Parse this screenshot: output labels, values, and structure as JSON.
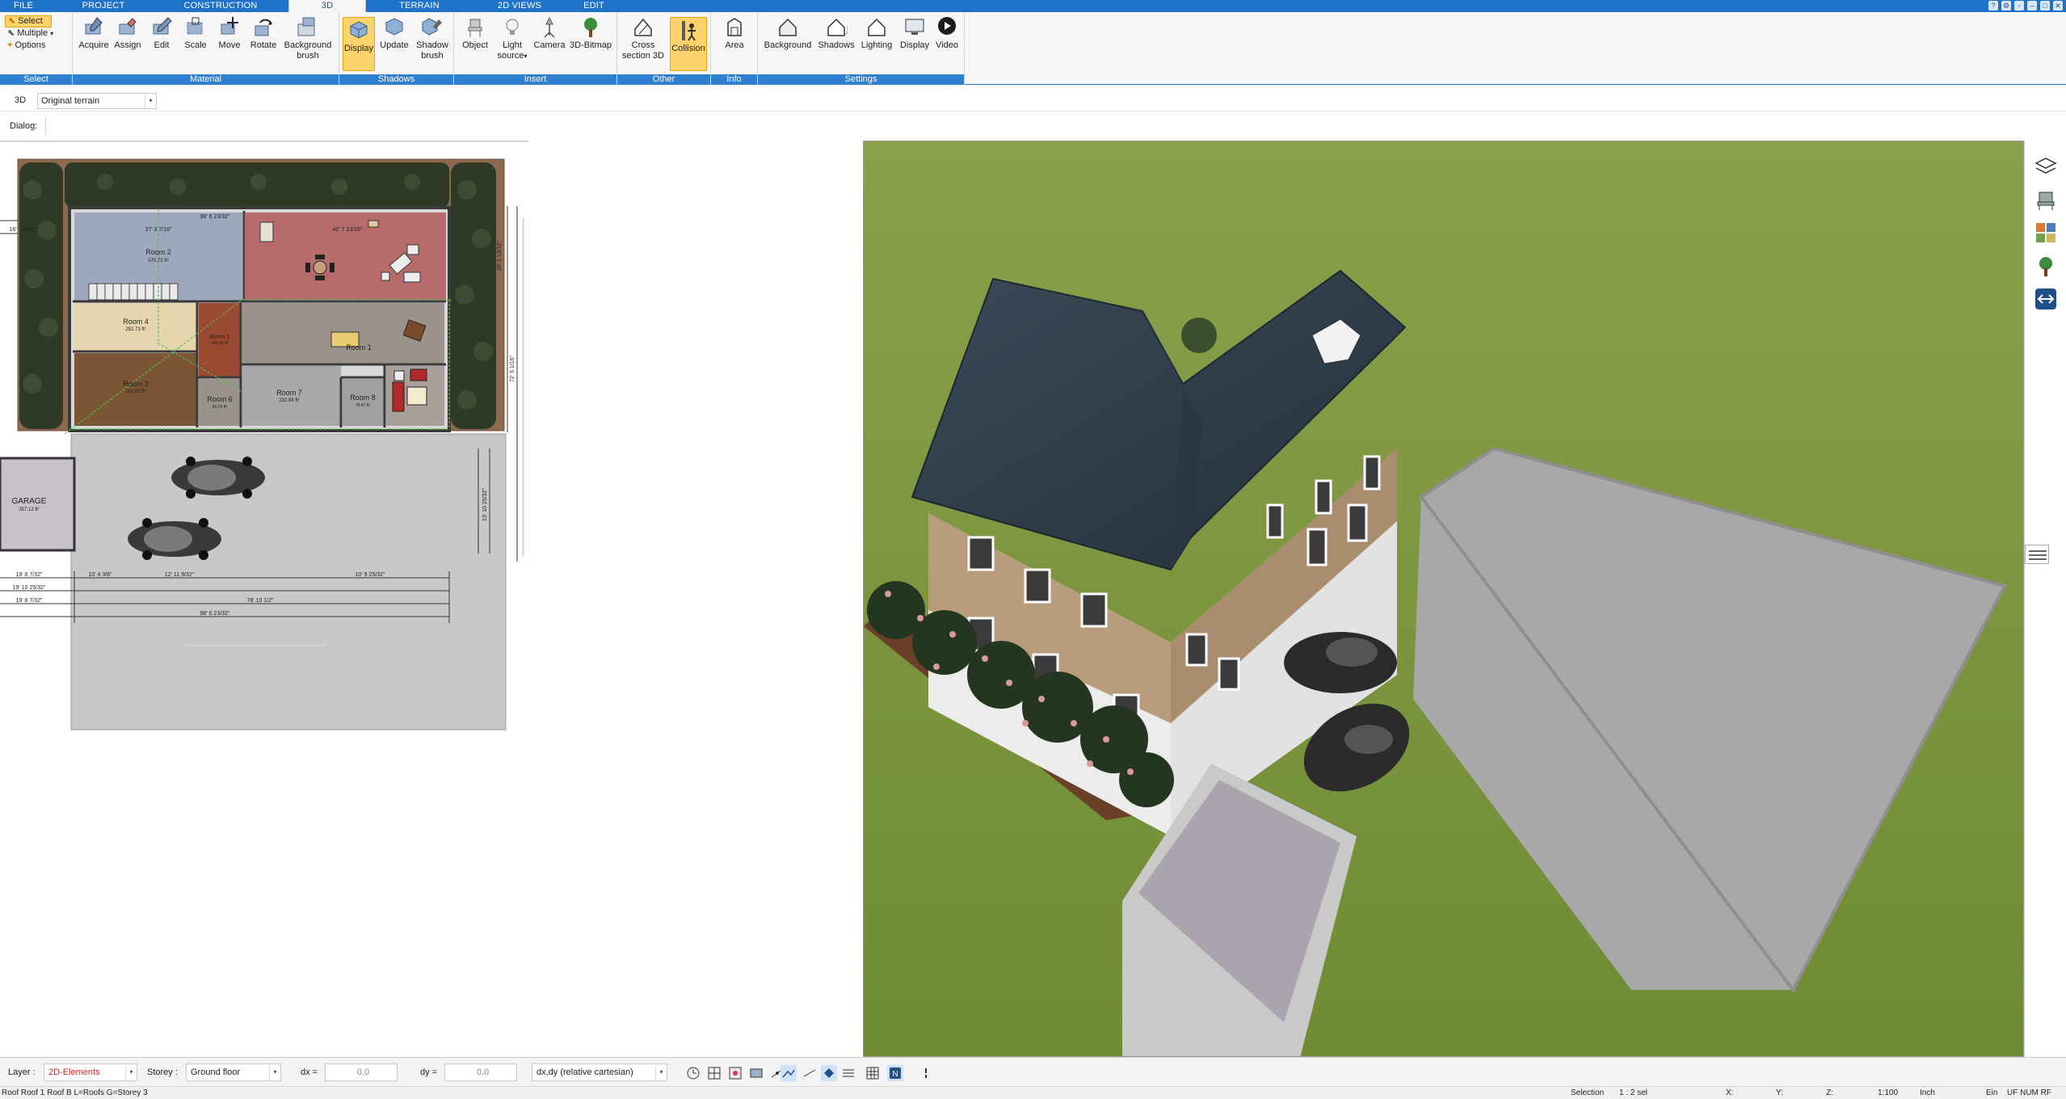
{
  "tabs": [
    {
      "label": "FILE",
      "active": false
    },
    {
      "label": "PROJECT",
      "active": false
    },
    {
      "label": "CONSTRUCTION",
      "active": false
    },
    {
      "label": "3D",
      "active": true
    },
    {
      "label": "TERRAIN",
      "active": false
    },
    {
      "label": "2D VIEWS",
      "active": false
    },
    {
      "label": "EDIT",
      "active": false
    }
  ],
  "select_group": {
    "select": "Select",
    "multiple": "Multiple",
    "options": "Options",
    "label": "Select"
  },
  "groups": {
    "material": "Material",
    "shadows": "Shadows",
    "insert": "Insert",
    "other": "Other",
    "info": "Info",
    "settings": "Settings"
  },
  "buttons": {
    "acquire": "Acquire",
    "assign": "Assign",
    "edit": "Edit",
    "scale": "Scale",
    "move": "Move",
    "rotate": "Rotate",
    "background_brush_1": "Background",
    "background_brush_2": "brush",
    "display": "Display",
    "update": "Update",
    "shadow_brush_1": "Shadow",
    "shadow_brush_2": "brush",
    "object": "Object",
    "light_source_1": "Light",
    "light_source_2": "source",
    "camera": "Camera",
    "bitmap": "3D-Bitmap",
    "cross_section_1": "Cross",
    "cross_section_2": "section 3D",
    "collision": "Collision",
    "area": "Area",
    "background": "Background",
    "shadows": "Shadows",
    "lighting": "Lighting",
    "display2": "Display",
    "video": "Video"
  },
  "toolbar2": {
    "mode": "3D",
    "terrain": "Original terrain",
    "dialog_label": "Dialog:"
  },
  "plan": {
    "rooms": [
      {
        "name": "Room 2",
        "area": "570.73 ft²"
      },
      {
        "name": "Room 4",
        "area": "252.73 ft²"
      },
      {
        "name": "Room 3",
        "area": "263.55 ft²"
      },
      {
        "name": "Room 1",
        "area": ""
      },
      {
        "name": "Room 5",
        "area": "140.33 ft²"
      },
      {
        "name": "Room 6",
        "area": "81.29 ft²"
      },
      {
        "name": "Room 7",
        "area": "232.69 ft²"
      },
      {
        "name": "Room 8",
        "area": "78.47 ft²"
      },
      {
        "name": "GARAGE",
        "area": "357.12 ft²"
      }
    ],
    "dims_top": [
      "98' 6 23/32\"",
      "16' 7 15/32\"",
      "37' 3 7/16\"",
      "42' 7 13/16\""
    ],
    "dims_bottom": [
      "98' 6 23/32\"",
      "78' 10 1/2\"",
      "19' 8 7/32\"",
      "19' 10 25/32\"",
      "19' 8 7/32\"",
      "10' 4 3/8\"",
      "12' 11 9/32\"",
      "10' 9 25/32\""
    ],
    "dims_right": [
      "72' 5 1/16\"",
      "28' 1 13/32\"",
      "13' 10 25/32\""
    ]
  },
  "bottombar": {
    "layer_label": "Layer :",
    "layer_value": "2D-Elements",
    "storey_label": "Storey :",
    "storey_value": "Ground floor",
    "dx_label": "dx =",
    "dx_value": "0.0",
    "dy_label": "dy =",
    "dy_value": "0.0",
    "coord_mode": "dx,dy (relative cartesian)"
  },
  "status": {
    "left": "Roof Roof 1 Roof B L=Roofs G=Storey 3",
    "selection": "Selection",
    "selection_count": "1 : 2 sel",
    "x": "X:",
    "y": "Y:",
    "z": "Z:",
    "scale": "1:100",
    "unit": "Inch",
    "ein": "Ein",
    "flags": "UF NUM RF"
  },
  "colors": {
    "ribbon_blue": "#1e73c8",
    "active_yellow": "#ffd36b",
    "lawn": "#7e9a3e",
    "roof": "#2f3d4a",
    "paving": "#aaaaaa"
  }
}
